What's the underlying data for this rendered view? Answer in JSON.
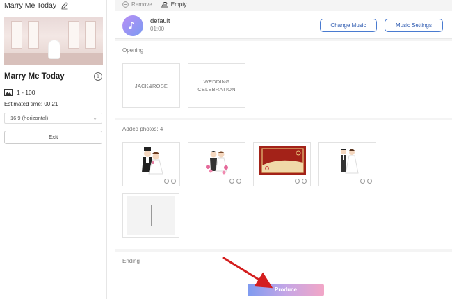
{
  "sidebar": {
    "project_title": "Marry Me Today",
    "project_name": "Marry Me Today",
    "info_icon_glyph": "i",
    "range": "1 - 100",
    "estimated_time": "Estimated time: 00:21",
    "ratio_value": "16:9 (horizontal)",
    "exit_label": "Exit"
  },
  "toolbar": {
    "remove_label": "Remove",
    "empty_label": "Empty"
  },
  "music": {
    "name": "default",
    "time": "01:00",
    "change_label": "Change Music",
    "settings_label": "Music Settings"
  },
  "opening": {
    "title": "Opening",
    "cards": [
      "JACK&ROSE",
      "WEDDING CELEBRATION"
    ]
  },
  "photos": {
    "title": "Added photos: 4"
  },
  "ending": {
    "title": "Ending"
  },
  "footer": {
    "produce_label": "Produce"
  },
  "colors": {
    "accent_blue": "#2d5ab0",
    "annotation_arrow": "#d41e1e",
    "produce_gradient_start": "#7e9bf0",
    "produce_gradient_end": "#f2a6c6"
  }
}
